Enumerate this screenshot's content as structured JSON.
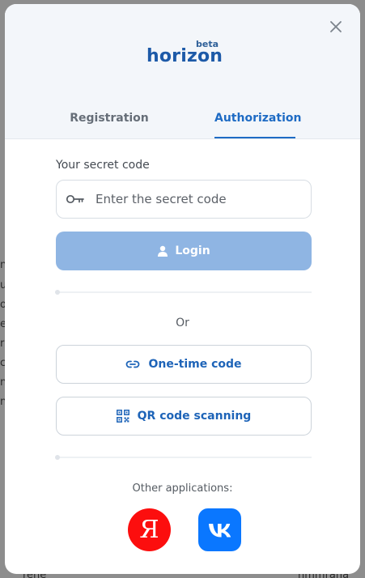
{
  "background": {
    "fragments": [
      "n",
      "u",
      "o",
      "e",
      "r",
      "c",
      "n",
      "n",
      "rene",
      "nmmrana"
    ]
  },
  "logo": {
    "word": "horizon",
    "badge": "beta"
  },
  "tabs": {
    "registration": "Registration",
    "authorization": "Authorization",
    "active": "authorization"
  },
  "form": {
    "secret_label": "Your secret code",
    "secret_placeholder": "Enter the secret code",
    "secret_value": "",
    "login_label": "Login"
  },
  "alternatives": {
    "or_text": "Or",
    "one_time_label": "One-time code",
    "qr_label": "QR code scanning"
  },
  "other_apps": {
    "label": "Other applications:",
    "yandex_glyph": "Я",
    "apps": [
      "yandex-icon",
      "vk-icon"
    ]
  },
  "colors": {
    "accent": "#1e6bc4",
    "login_bg": "#8fb5e3",
    "yandex": "#fc0e0e",
    "vk": "#0a77ff"
  }
}
